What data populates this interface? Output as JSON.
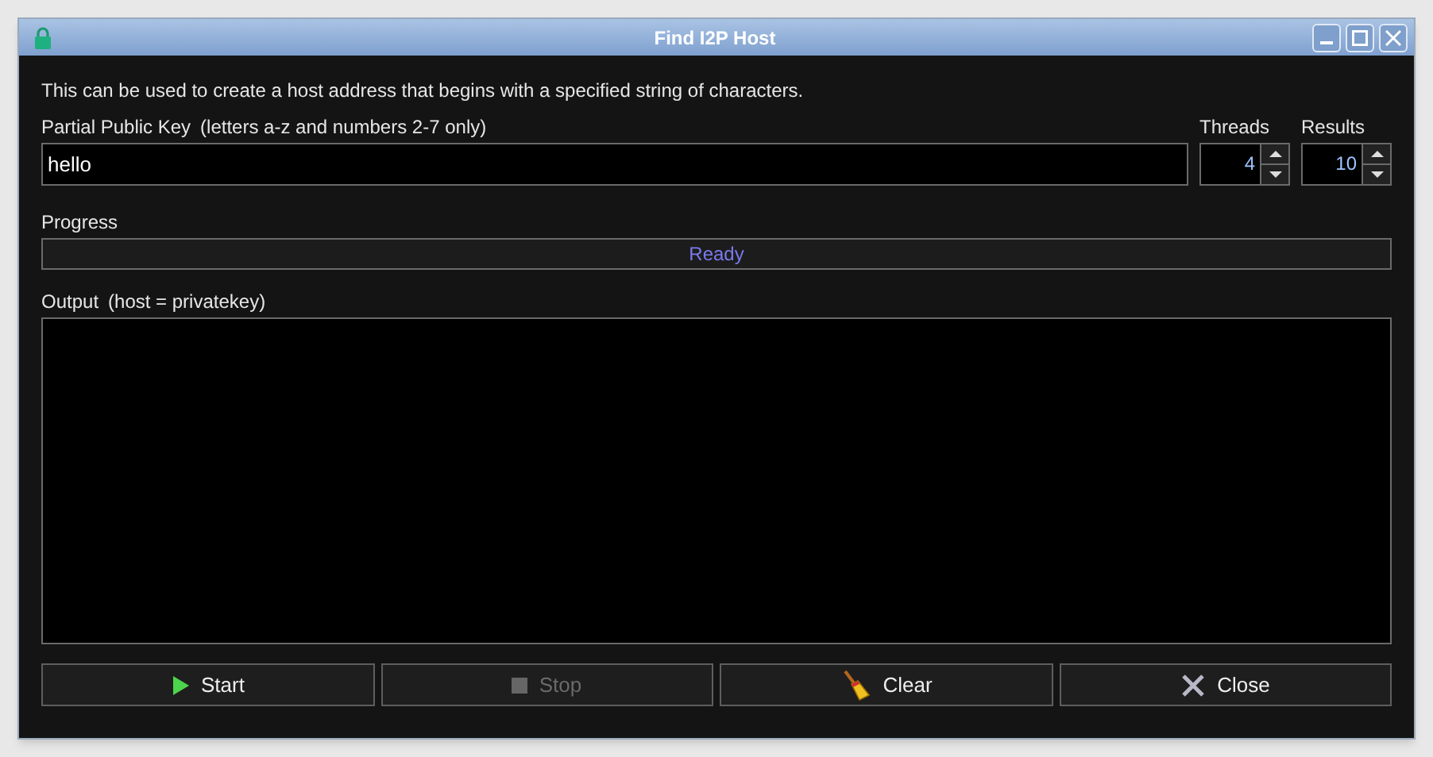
{
  "window": {
    "title": "Find I2P Host"
  },
  "description": "This can be used to create a host address that begins with a specified string of characters.",
  "key_field": {
    "label": "Partial Public Key",
    "hint": "(letters a-z and numbers 2-7 only)",
    "value": "hello"
  },
  "spinners": [
    {
      "label": "Threads",
      "value": "4"
    },
    {
      "label": "Results",
      "value": "10"
    }
  ],
  "progress": {
    "label": "Progress",
    "level": 0,
    "text": "Ready"
  },
  "output": {
    "label": "Output",
    "hint": "(host = privatekey)"
  },
  "buttons": [
    {
      "label": "Start",
      "kind": "start",
      "disabled": false
    },
    {
      "label": "Stop",
      "kind": "stop",
      "disabled": true
    },
    {
      "label": "Clear",
      "kind": "clear",
      "disabled": false
    },
    {
      "label": "Close",
      "kind": "close",
      "disabled": false
    }
  ]
}
